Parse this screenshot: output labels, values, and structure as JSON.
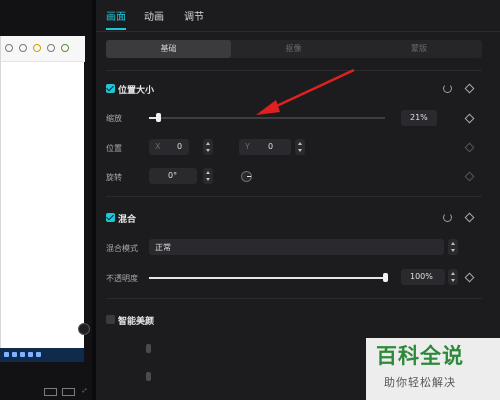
{
  "tabs": [
    {
      "label": "画面"
    },
    {
      "label": "动画"
    },
    {
      "label": "调节"
    }
  ],
  "segments": [
    {
      "label": "基础"
    },
    {
      "label": "抠像"
    },
    {
      "label": "蒙版"
    }
  ],
  "position_size": {
    "title": "位置大小",
    "scale_label": "缩放",
    "scale_value": "21%",
    "scale_fraction": 0.04,
    "position_label": "位置",
    "x_prefix": "X",
    "x_value": "0",
    "y_prefix": "Y",
    "y_value": "0",
    "rotate_label": "旋转",
    "rotate_value": "0°"
  },
  "blend": {
    "title": "混合",
    "mode_label": "混合模式",
    "mode_value": "正常",
    "opacity_label": "不透明度",
    "opacity_value": "100%",
    "opacity_fraction": 1.0
  },
  "beauty": {
    "title": "智能美颜"
  },
  "watermark": {
    "title": "百科全说",
    "subtitle": "助你轻松解决"
  },
  "colors": {
    "accent": "#1fc6d8",
    "arrow": "#e02020"
  },
  "icons": {
    "reset": "reset-icon",
    "keyframe": "diamond-keyframe-icon",
    "rotate": "rotate-dial-icon"
  }
}
